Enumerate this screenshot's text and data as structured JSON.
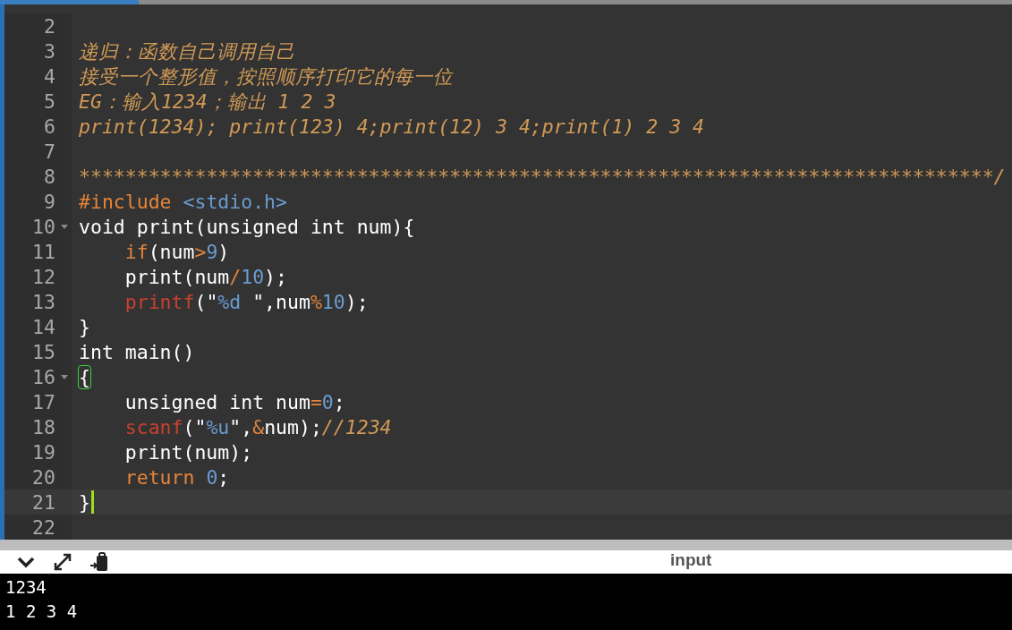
{
  "editor": {
    "lines": [
      {
        "number": "2",
        "fold": false,
        "current": false
      },
      {
        "number": "3",
        "fold": false,
        "current": false,
        "tokens": [
          {
            "kind": "comment",
            "text": "递归：函数自己调用自己"
          }
        ]
      },
      {
        "number": "4",
        "fold": false,
        "current": false,
        "tokens": [
          {
            "kind": "comment",
            "text": "接受一个整形值，按照顺序打印它的每一位"
          }
        ]
      },
      {
        "number": "5",
        "fold": false,
        "current": false,
        "tokens": [
          {
            "kind": "comment",
            "text": "EG：输入1234；输出 1 2 3"
          }
        ]
      },
      {
        "number": "6",
        "fold": false,
        "current": false,
        "tokens": [
          {
            "kind": "comment",
            "text": "print(1234); print(123) 4;print(12) 3 4;print(1) 2 3 4"
          }
        ]
      },
      {
        "number": "7",
        "fold": false,
        "current": false
      },
      {
        "number": "8",
        "fold": false,
        "current": false,
        "tokens": [
          {
            "kind": "comment",
            "text": "*******************************************************************************/"
          }
        ]
      },
      {
        "number": "9",
        "fold": false,
        "current": false,
        "tokens": [
          {
            "kind": "keyword",
            "text": "#include"
          },
          {
            "kind": "literal",
            "text": " <stdio.h>"
          }
        ]
      },
      {
        "number": "10",
        "fold": true,
        "current": false,
        "tokens": [
          {
            "kind": "plain",
            "text": "void print(unsigned int num){"
          }
        ]
      },
      {
        "number": "11",
        "fold": false,
        "current": false,
        "indent": true,
        "tokens": [
          {
            "kind": "keyword",
            "text": "if"
          },
          {
            "kind": "plain",
            "text": "(num"
          },
          {
            "kind": "keyword",
            "text": ">"
          },
          {
            "kind": "literal",
            "text": "9"
          },
          {
            "kind": "plain",
            "text": ")"
          }
        ]
      },
      {
        "number": "12",
        "fold": false,
        "current": false,
        "indent": true,
        "tokens": [
          {
            "kind": "plain",
            "text": "print(num"
          },
          {
            "kind": "keyword",
            "text": "/"
          },
          {
            "kind": "literal",
            "text": "10"
          },
          {
            "kind": "plain",
            "text": ");"
          }
        ]
      },
      {
        "number": "13",
        "fold": false,
        "current": false,
        "indent": true,
        "tokens": [
          {
            "kind": "function",
            "text": "printf"
          },
          {
            "kind": "plain",
            "text": "(\""
          },
          {
            "kind": "literal",
            "text": "%d "
          },
          {
            "kind": "plain",
            "text": "\",num"
          },
          {
            "kind": "keyword",
            "text": "%"
          },
          {
            "kind": "literal",
            "text": "10"
          },
          {
            "kind": "plain",
            "text": ");"
          }
        ]
      },
      {
        "number": "14",
        "fold": false,
        "current": false,
        "tokens": [
          {
            "kind": "plain",
            "text": "}"
          }
        ]
      },
      {
        "number": "15",
        "fold": false,
        "current": false,
        "tokens": [
          {
            "kind": "plain",
            "text": "int main()"
          }
        ]
      },
      {
        "number": "16",
        "fold": true,
        "current": false,
        "tokens": [
          {
            "kind": "matched-brace",
            "text": "{"
          }
        ]
      },
      {
        "number": "17",
        "fold": false,
        "current": false,
        "indent": true,
        "tokens": [
          {
            "kind": "plain",
            "text": "unsigned int num"
          },
          {
            "kind": "keyword",
            "text": "="
          },
          {
            "kind": "literal",
            "text": "0"
          },
          {
            "kind": "plain",
            "text": ";"
          }
        ]
      },
      {
        "number": "18",
        "fold": false,
        "current": false,
        "indent": true,
        "tokens": [
          {
            "kind": "function",
            "text": "scanf"
          },
          {
            "kind": "plain",
            "text": "(\""
          },
          {
            "kind": "literal",
            "text": "%u"
          },
          {
            "kind": "plain",
            "text": "\","
          },
          {
            "kind": "keyword",
            "text": "&"
          },
          {
            "kind": "plain",
            "text": "num);"
          },
          {
            "kind": "comment",
            "text": "//1234"
          }
        ]
      },
      {
        "number": "19",
        "fold": false,
        "current": false,
        "indent": true,
        "tokens": [
          {
            "kind": "plain",
            "text": "print(num);"
          }
        ]
      },
      {
        "number": "20",
        "fold": false,
        "current": false,
        "indent": true,
        "tokens": [
          {
            "kind": "keyword",
            "text": "return"
          },
          {
            "kind": "literal",
            "text": " 0"
          },
          {
            "kind": "plain",
            "text": ";"
          }
        ]
      },
      {
        "number": "21",
        "fold": false,
        "current": true,
        "tokens": [
          {
            "kind": "plain",
            "text": "}"
          }
        ]
      },
      {
        "number": "22",
        "fold": false,
        "current": false
      }
    ]
  },
  "console": {
    "title": "input",
    "output": [
      "1234",
      "1 2 3 4"
    ]
  }
}
